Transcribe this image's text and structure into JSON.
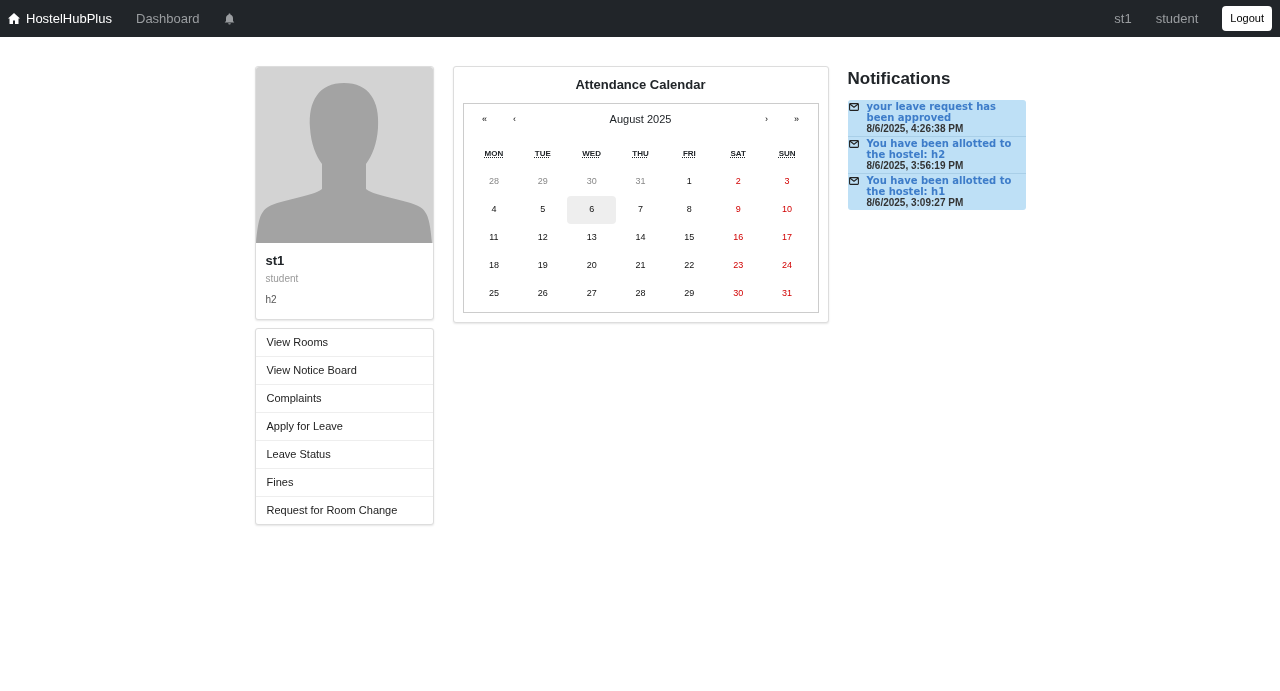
{
  "navbar": {
    "brand": "HostelHubPlus",
    "links": [
      {
        "label": "Dashboard"
      }
    ],
    "user": "st1",
    "role": "student",
    "logout": "Logout"
  },
  "profile": {
    "name": "st1",
    "role": "student",
    "hostel": "h2"
  },
  "menu": [
    {
      "label": "View Rooms"
    },
    {
      "label": "View Notice Board"
    },
    {
      "label": "Complaints"
    },
    {
      "label": "Apply for Leave"
    },
    {
      "label": "Leave Status"
    },
    {
      "label": "Fines"
    },
    {
      "label": "Request for Room Change"
    }
  ],
  "calendar": {
    "title": "Attendance Calendar",
    "month": "August 2025",
    "nav": [
      "«",
      "‹",
      "›",
      "»"
    ],
    "weekdays": [
      "MON",
      "TUE",
      "WED",
      "THU",
      "FRI",
      "SAT",
      "SUN"
    ],
    "days": [
      {
        "label": "28",
        "kind": "neighbor",
        "selected": false
      },
      {
        "label": "29",
        "kind": "neighbor",
        "selected": false
      },
      {
        "label": "30",
        "kind": "neighbor",
        "selected": false
      },
      {
        "label": "31",
        "kind": "neighbor",
        "selected": false
      },
      {
        "label": "1",
        "kind": "weekday",
        "selected": false
      },
      {
        "label": "2",
        "kind": "weekend",
        "selected": false
      },
      {
        "label": "3",
        "kind": "weekend",
        "selected": false
      },
      {
        "label": "4",
        "kind": "weekday",
        "selected": false
      },
      {
        "label": "5",
        "kind": "weekday",
        "selected": false
      },
      {
        "label": "6",
        "kind": "weekday",
        "selected": true
      },
      {
        "label": "7",
        "kind": "weekday",
        "selected": false
      },
      {
        "label": "8",
        "kind": "weekday",
        "selected": false
      },
      {
        "label": "9",
        "kind": "weekend",
        "selected": false
      },
      {
        "label": "10",
        "kind": "weekend",
        "selected": false
      },
      {
        "label": "11",
        "kind": "weekday",
        "selected": false
      },
      {
        "label": "12",
        "kind": "weekday",
        "selected": false
      },
      {
        "label": "13",
        "kind": "weekday",
        "selected": false
      },
      {
        "label": "14",
        "kind": "weekday",
        "selected": false
      },
      {
        "label": "15",
        "kind": "weekday",
        "selected": false
      },
      {
        "label": "16",
        "kind": "weekend",
        "selected": false
      },
      {
        "label": "17",
        "kind": "weekend",
        "selected": false
      },
      {
        "label": "18",
        "kind": "weekday",
        "selected": false
      },
      {
        "label": "19",
        "kind": "weekday",
        "selected": false
      },
      {
        "label": "20",
        "kind": "weekday",
        "selected": false
      },
      {
        "label": "21",
        "kind": "weekday",
        "selected": false
      },
      {
        "label": "22",
        "kind": "weekday",
        "selected": false
      },
      {
        "label": "23",
        "kind": "weekend",
        "selected": false
      },
      {
        "label": "24",
        "kind": "weekend",
        "selected": false
      },
      {
        "label": "25",
        "kind": "weekday",
        "selected": false
      },
      {
        "label": "26",
        "kind": "weekday",
        "selected": false
      },
      {
        "label": "27",
        "kind": "weekday",
        "selected": false
      },
      {
        "label": "28",
        "kind": "weekday",
        "selected": false
      },
      {
        "label": "29",
        "kind": "weekday",
        "selected": false
      },
      {
        "label": "30",
        "kind": "weekend",
        "selected": false
      },
      {
        "label": "31",
        "kind": "weekend",
        "selected": false
      }
    ]
  },
  "notifications": {
    "title": "Notifications",
    "items": [
      {
        "message": "your leave request has been approved",
        "time": "8/6/2025, 4:26:38 PM"
      },
      {
        "message": "You have been allotted to the hostel: h2",
        "time": "8/6/2025, 3:56:19 PM"
      },
      {
        "message": "You have been allotted to the hostel: h1",
        "time": "8/6/2025, 3:09:27 PM"
      }
    ]
  }
}
